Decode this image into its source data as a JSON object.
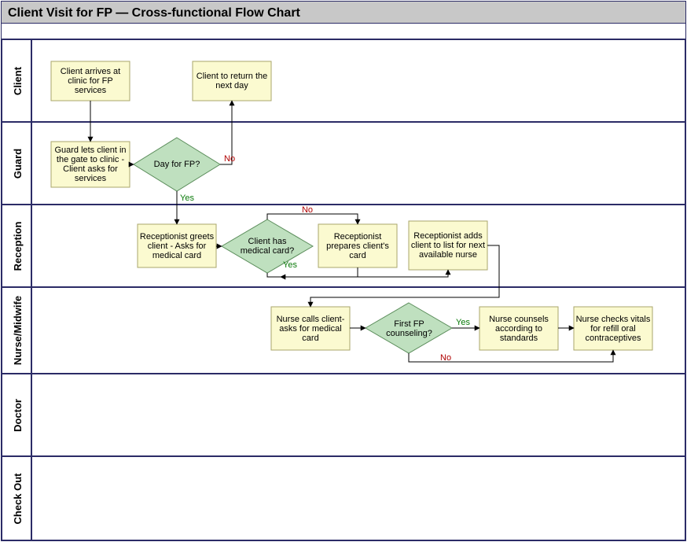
{
  "title": "Client Visit for FP — Cross-functional Flow Chart",
  "lanes": {
    "client": "Client",
    "guard": "Guard",
    "reception": "Reception",
    "nurse": "Nurse/Midwife",
    "doctor": "Doctor",
    "checkout": "Check Out"
  },
  "nodes": {
    "client_arrives": "Client arrives at clinic for FP services",
    "client_return": "Client to return the next day",
    "guard_lets": "Guard lets client in the gate to clinic - Client asks for services",
    "day_for_fp": "Day for FP?",
    "recep_greets": "Receptionist greets client - Asks for medical card",
    "has_card": "Client has medical card?",
    "recep_prepares": "Receptionist prepares client's card",
    "recep_adds": "Receptionist adds client to list for next available nurse",
    "nurse_calls": "Nurse calls client- asks for medical card",
    "first_fp": "First FP counseling?",
    "nurse_counsels": "Nurse counsels according to standards",
    "nurse_checks": "Nurse checks vitals for refill oral contraceptives"
  },
  "edge_labels": {
    "yes": "Yes",
    "no": "No"
  }
}
